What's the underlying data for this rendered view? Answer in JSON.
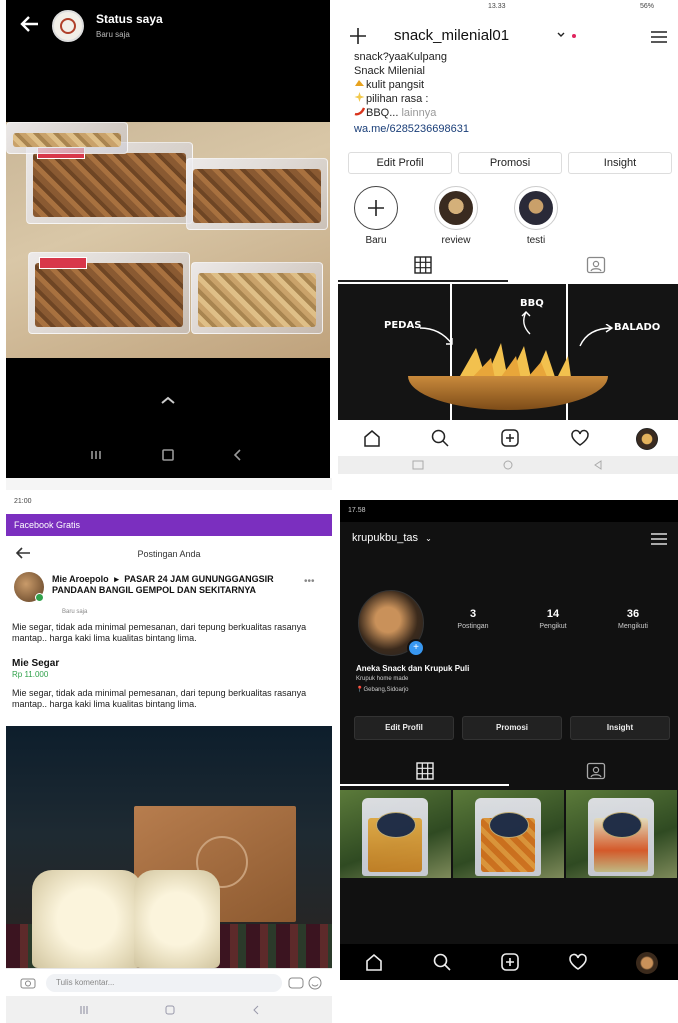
{
  "status_panel": {
    "title": "Status saya",
    "time": "Baru saja"
  },
  "ig_light": {
    "status_time": "13.33",
    "status_battery": "56%",
    "username": "snack_milenial01",
    "bio": [
      "snack?yaaKulpang",
      "Snack Milenial",
      "kulit pangsit",
      "pilihan rasa :",
      "BBQ..."
    ],
    "bio_more": "lainnya",
    "link": "wa.me/6285236698631",
    "buttons": [
      "Edit Profil",
      "Promosi",
      "Insight"
    ],
    "highlights": [
      "Baru",
      "review",
      "testi"
    ],
    "grid_labels": [
      "PEDAS",
      "BBQ",
      "BALADO"
    ]
  },
  "fb_post": {
    "status_top": "21:00",
    "fb_bar": "Facebook Gratis",
    "header_title": "Postingan Anda",
    "author": "Mie Aroepolo",
    "group_title": "PASAR 24 JAM GUNUNGGANGSIR PANDAAN BANGIL GEMPOL DAN SEKITARNYA",
    "post_time": "Baru saja",
    "text1": "Mie segar, tidak ada minimal pemesanan, dari tepung berkualitas rasanya mantap.. harga kaki lima kualitas bintang lima.",
    "product_name": "Mie Segar",
    "product_price": "Rp 11.000",
    "text2": "Mie segar, tidak ada minimal pemesanan, dari tepung berkualitas rasanya mantap.. harga kaki lima kualitas bintang lima.",
    "comment_placeholder": "Tulis komentar..."
  },
  "ig_dark": {
    "status_time": "17.58",
    "username": "krupukbu_tas",
    "stats": [
      {
        "value": "3",
        "label": "Postingan"
      },
      {
        "value": "14",
        "label": "Pengikut"
      },
      {
        "value": "36",
        "label": "Mengikuti"
      }
    ],
    "bio_name": "Aneka Snack dan Krupuk Puli",
    "bio_desc": "Krupuk home made",
    "bio_location": "Gebang,Sidoarjo",
    "buttons": [
      "Edit Profil",
      "Promosi",
      "Insight"
    ]
  },
  "colors": {
    "fb_purple": "#7b2fbf",
    "ig_link": "#1a3e78",
    "green": "#31a24c"
  }
}
